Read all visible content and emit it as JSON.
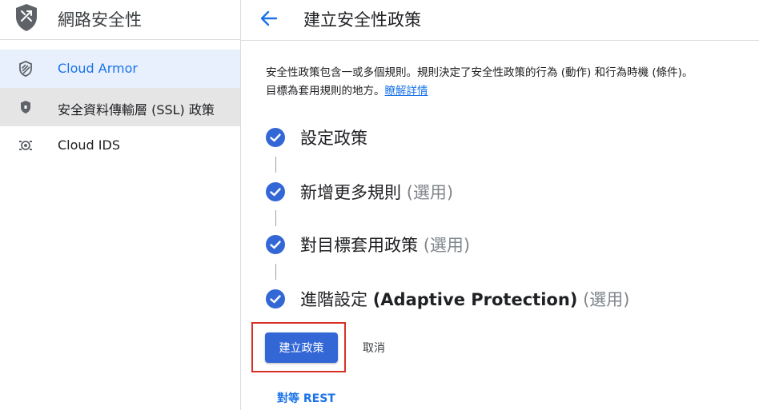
{
  "sidebar": {
    "title": "網路安全性",
    "items": [
      {
        "label": "Cloud Armor",
        "icon": "shield-stripes-icon",
        "state": "active"
      },
      {
        "label": "安全資料傳輸層 (SSL) 政策",
        "icon": "shield-lock-icon",
        "state": "hover"
      },
      {
        "label": "Cloud IDS",
        "icon": "ids-eye-icon",
        "state": "normal"
      }
    ]
  },
  "header": {
    "title": "建立安全性政策"
  },
  "description": {
    "line1": "安全性政策包含一或多個規則。規則決定了安全性政策的行為 (動作) 和行為時機 (條件)。",
    "line2": "目標為套用規則的地方。",
    "learn_more": "瞭解詳情"
  },
  "steps": [
    {
      "label": "設定政策",
      "optional": ""
    },
    {
      "label": "新增更多規則",
      "optional": "(選用)"
    },
    {
      "label": "對目標套用政策",
      "optional": "(選用)"
    },
    {
      "label": "進階設定 ",
      "bold": "(Adaptive Protection)",
      "optional": "(選用)"
    }
  ],
  "actions": {
    "create_label": "建立政策",
    "cancel_label": "取消",
    "rest_label": "對等 REST"
  },
  "colors": {
    "accent": "#1a73e8",
    "button": "#3367d6",
    "check": "#3367d6",
    "highlight": "#d93025",
    "active_bg": "#e8f0fe",
    "hover_bg": "#e5e5e5"
  }
}
